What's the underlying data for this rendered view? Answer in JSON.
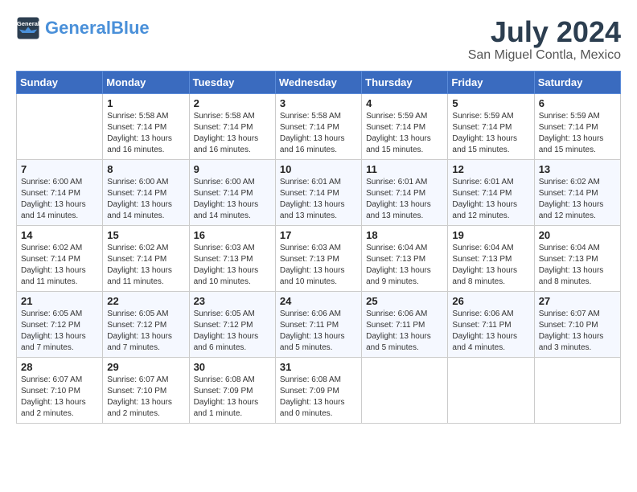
{
  "header": {
    "logo_general": "General",
    "logo_blue": "Blue",
    "month_year": "July 2024",
    "location": "San Miguel Contla, Mexico"
  },
  "days_of_week": [
    "Sunday",
    "Monday",
    "Tuesday",
    "Wednesday",
    "Thursday",
    "Friday",
    "Saturday"
  ],
  "weeks": [
    [
      {
        "day": "",
        "sunrise": "",
        "sunset": "",
        "daylight": ""
      },
      {
        "day": "1",
        "sunrise": "Sunrise: 5:58 AM",
        "sunset": "Sunset: 7:14 PM",
        "daylight": "Daylight: 13 hours and 16 minutes."
      },
      {
        "day": "2",
        "sunrise": "Sunrise: 5:58 AM",
        "sunset": "Sunset: 7:14 PM",
        "daylight": "Daylight: 13 hours and 16 minutes."
      },
      {
        "day": "3",
        "sunrise": "Sunrise: 5:58 AM",
        "sunset": "Sunset: 7:14 PM",
        "daylight": "Daylight: 13 hours and 16 minutes."
      },
      {
        "day": "4",
        "sunrise": "Sunrise: 5:59 AM",
        "sunset": "Sunset: 7:14 PM",
        "daylight": "Daylight: 13 hours and 15 minutes."
      },
      {
        "day": "5",
        "sunrise": "Sunrise: 5:59 AM",
        "sunset": "Sunset: 7:14 PM",
        "daylight": "Daylight: 13 hours and 15 minutes."
      },
      {
        "day": "6",
        "sunrise": "Sunrise: 5:59 AM",
        "sunset": "Sunset: 7:14 PM",
        "daylight": "Daylight: 13 hours and 15 minutes."
      }
    ],
    [
      {
        "day": "7",
        "sunrise": "Sunrise: 6:00 AM",
        "sunset": "Sunset: 7:14 PM",
        "daylight": "Daylight: 13 hours and 14 minutes."
      },
      {
        "day": "8",
        "sunrise": "Sunrise: 6:00 AM",
        "sunset": "Sunset: 7:14 PM",
        "daylight": "Daylight: 13 hours and 14 minutes."
      },
      {
        "day": "9",
        "sunrise": "Sunrise: 6:00 AM",
        "sunset": "Sunset: 7:14 PM",
        "daylight": "Daylight: 13 hours and 14 minutes."
      },
      {
        "day": "10",
        "sunrise": "Sunrise: 6:01 AM",
        "sunset": "Sunset: 7:14 PM",
        "daylight": "Daylight: 13 hours and 13 minutes."
      },
      {
        "day": "11",
        "sunrise": "Sunrise: 6:01 AM",
        "sunset": "Sunset: 7:14 PM",
        "daylight": "Daylight: 13 hours and 13 minutes."
      },
      {
        "day": "12",
        "sunrise": "Sunrise: 6:01 AM",
        "sunset": "Sunset: 7:14 PM",
        "daylight": "Daylight: 13 hours and 12 minutes."
      },
      {
        "day": "13",
        "sunrise": "Sunrise: 6:02 AM",
        "sunset": "Sunset: 7:14 PM",
        "daylight": "Daylight: 13 hours and 12 minutes."
      }
    ],
    [
      {
        "day": "14",
        "sunrise": "Sunrise: 6:02 AM",
        "sunset": "Sunset: 7:14 PM",
        "daylight": "Daylight: 13 hours and 11 minutes."
      },
      {
        "day": "15",
        "sunrise": "Sunrise: 6:02 AM",
        "sunset": "Sunset: 7:14 PM",
        "daylight": "Daylight: 13 hours and 11 minutes."
      },
      {
        "day": "16",
        "sunrise": "Sunrise: 6:03 AM",
        "sunset": "Sunset: 7:13 PM",
        "daylight": "Daylight: 13 hours and 10 minutes."
      },
      {
        "day": "17",
        "sunrise": "Sunrise: 6:03 AM",
        "sunset": "Sunset: 7:13 PM",
        "daylight": "Daylight: 13 hours and 10 minutes."
      },
      {
        "day": "18",
        "sunrise": "Sunrise: 6:04 AM",
        "sunset": "Sunset: 7:13 PM",
        "daylight": "Daylight: 13 hours and 9 minutes."
      },
      {
        "day": "19",
        "sunrise": "Sunrise: 6:04 AM",
        "sunset": "Sunset: 7:13 PM",
        "daylight": "Daylight: 13 hours and 8 minutes."
      },
      {
        "day": "20",
        "sunrise": "Sunrise: 6:04 AM",
        "sunset": "Sunset: 7:13 PM",
        "daylight": "Daylight: 13 hours and 8 minutes."
      }
    ],
    [
      {
        "day": "21",
        "sunrise": "Sunrise: 6:05 AM",
        "sunset": "Sunset: 7:12 PM",
        "daylight": "Daylight: 13 hours and 7 minutes."
      },
      {
        "day": "22",
        "sunrise": "Sunrise: 6:05 AM",
        "sunset": "Sunset: 7:12 PM",
        "daylight": "Daylight: 13 hours and 7 minutes."
      },
      {
        "day": "23",
        "sunrise": "Sunrise: 6:05 AM",
        "sunset": "Sunset: 7:12 PM",
        "daylight": "Daylight: 13 hours and 6 minutes."
      },
      {
        "day": "24",
        "sunrise": "Sunrise: 6:06 AM",
        "sunset": "Sunset: 7:11 PM",
        "daylight": "Daylight: 13 hours and 5 minutes."
      },
      {
        "day": "25",
        "sunrise": "Sunrise: 6:06 AM",
        "sunset": "Sunset: 7:11 PM",
        "daylight": "Daylight: 13 hours and 5 minutes."
      },
      {
        "day": "26",
        "sunrise": "Sunrise: 6:06 AM",
        "sunset": "Sunset: 7:11 PM",
        "daylight": "Daylight: 13 hours and 4 minutes."
      },
      {
        "day": "27",
        "sunrise": "Sunrise: 6:07 AM",
        "sunset": "Sunset: 7:10 PM",
        "daylight": "Daylight: 13 hours and 3 minutes."
      }
    ],
    [
      {
        "day": "28",
        "sunrise": "Sunrise: 6:07 AM",
        "sunset": "Sunset: 7:10 PM",
        "daylight": "Daylight: 13 hours and 2 minutes."
      },
      {
        "day": "29",
        "sunrise": "Sunrise: 6:07 AM",
        "sunset": "Sunset: 7:10 PM",
        "daylight": "Daylight: 13 hours and 2 minutes."
      },
      {
        "day": "30",
        "sunrise": "Sunrise: 6:08 AM",
        "sunset": "Sunset: 7:09 PM",
        "daylight": "Daylight: 13 hours and 1 minute."
      },
      {
        "day": "31",
        "sunrise": "Sunrise: 6:08 AM",
        "sunset": "Sunset: 7:09 PM",
        "daylight": "Daylight: 13 hours and 0 minutes."
      },
      {
        "day": "",
        "sunrise": "",
        "sunset": "",
        "daylight": ""
      },
      {
        "day": "",
        "sunrise": "",
        "sunset": "",
        "daylight": ""
      },
      {
        "day": "",
        "sunrise": "",
        "sunset": "",
        "daylight": ""
      }
    ]
  ]
}
